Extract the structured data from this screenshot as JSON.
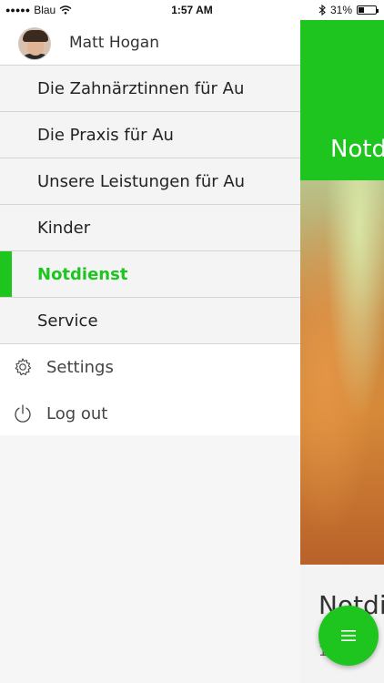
{
  "status_bar": {
    "signal_dots": "●●●●●",
    "carrier": "Blau",
    "time": "1:57 AM",
    "bluetooth_icon": "bluetooth-icon",
    "battery": "31%"
  },
  "drawer": {
    "profile": {
      "name": "Matt Hogan",
      "avatar_icon": "avatar"
    },
    "menu_items": [
      {
        "label": "Die Zahnärztinnen für Au",
        "active": false
      },
      {
        "label": "Die Praxis für Au",
        "active": false
      },
      {
        "label": "Unsere Leistungen für Au",
        "active": false
      },
      {
        "label": "Kinder",
        "active": false
      },
      {
        "label": "Notdienst",
        "active": true
      },
      {
        "label": "Service",
        "active": false
      }
    ],
    "system_items": [
      {
        "label": "Settings",
        "icon": "gear-icon"
      },
      {
        "label": "Log out",
        "icon": "power-icon"
      }
    ]
  },
  "background_app": {
    "header_title": "Notd",
    "card_title": "Notdi",
    "card_subtitle": "1",
    "fab_icon": "menu-icon"
  },
  "colors": {
    "accent": "#1ec51e",
    "drawer_bg": "#f6f6f6",
    "divider": "#d5d5d5"
  }
}
